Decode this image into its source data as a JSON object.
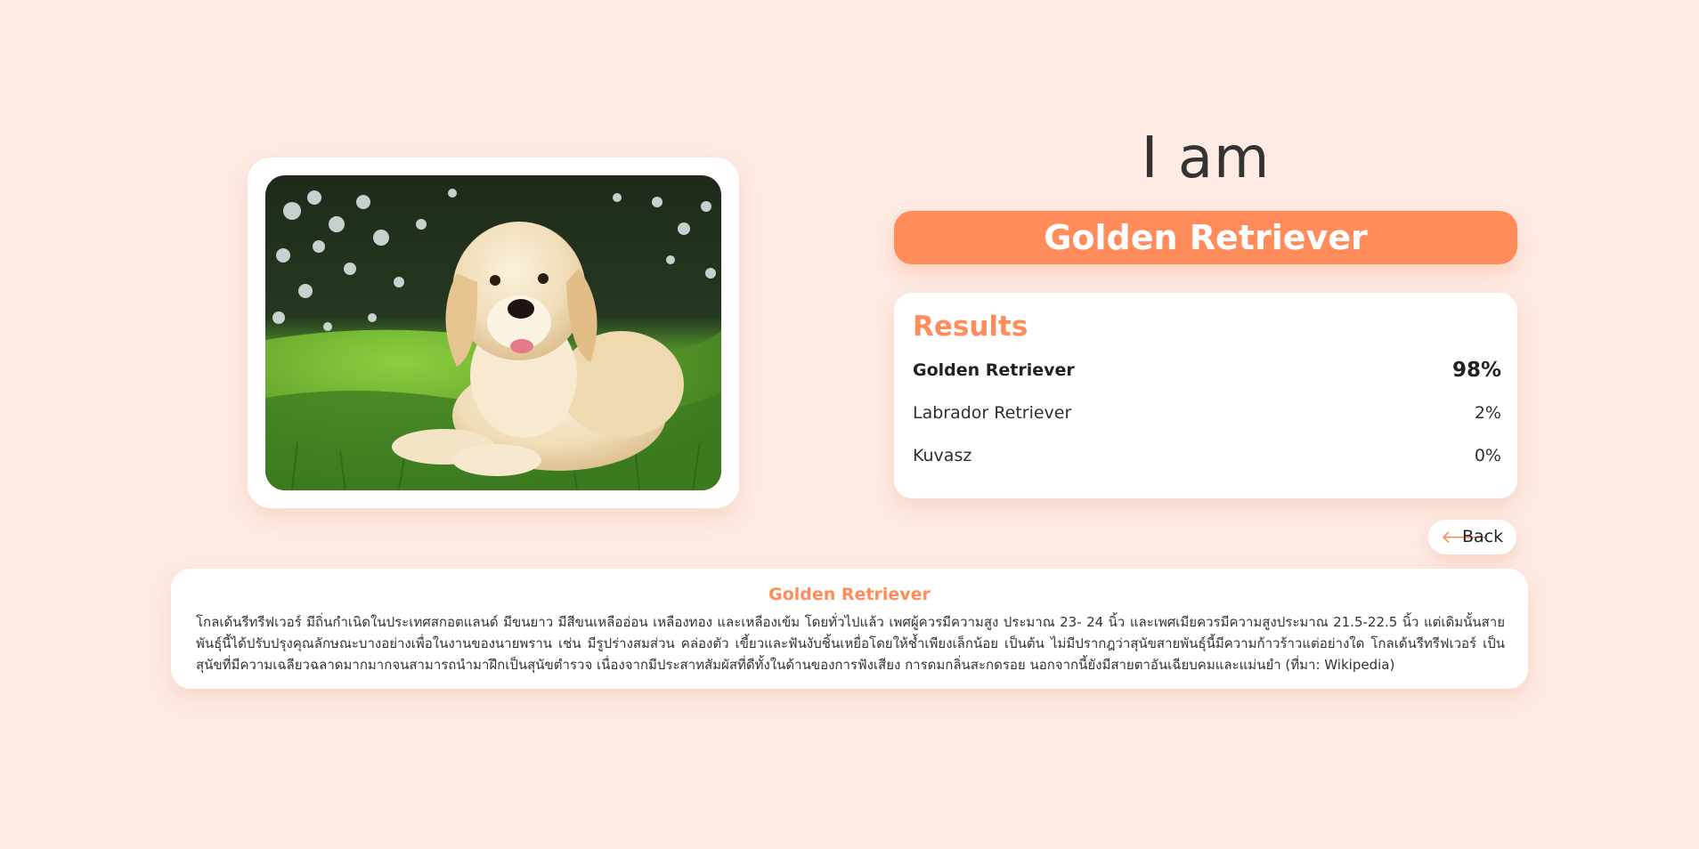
{
  "heading": "I am",
  "predicted_breed": "Golden Retriever",
  "photo": {
    "alt": "Golden Retriever puppy lying in grass"
  },
  "results": {
    "title": "Results",
    "items": [
      {
        "name": "Golden Retriever",
        "percent": "98%"
      },
      {
        "name": "Labrador Retriever",
        "percent": "2%"
      },
      {
        "name": "Kuvasz",
        "percent": "0%"
      }
    ]
  },
  "back_button": {
    "icon": "arrow-left-icon",
    "label": "Back"
  },
  "info": {
    "title": "Golden Retriever",
    "text": "โกลเด้นรีทรีฟเวอร์ มีถิ่นกำเนิดในประเทศสกอตแลนด์ มีขนยาว มีสีขนเหลืออ่อน เหลืองทอง และเหลืองเข้ม โดยทั่วไปแล้ว เพศผู้ควรมีความสูง ประมาณ 23- 24 นิ้ว และเพศเมียควรมีความสูงประมาณ 21.5-22.5 นิ้ว แต่เดิมนั้นสายพันธุ์นี้ได้ปรับปรุงคุณลักษณะบางอย่างเพื่อในงานของนายพราน เช่น มีรูปร่างสมส่วน คล่องตัว เขี้ยวและฟันงับชิ้นเหยื่อโดยให้ช้ำเพียงเล็กน้อย เป็นต้น ไม่มีปรากฎว่าสุนัขสายพันธุ์นี้มีความก้าวร้าวแต่อย่างใด โกลเด้นรีทรีฟเวอร์ เป็นสุนัขที่มีความเฉลียวฉลาดมากมากจนสามารถนำมาฝึกเป็นสุนัขตำรวจ เนื่องจากมีประสาทสัมผัสที่ดีทั้งในด้านของการฟังเสียง การดมกลิ่นสะกดรอย นอกจากนี้ยังมีสายตาอันเฉียบคมและแม่นยำ (ที่มา: Wikipedia)"
  },
  "colors": {
    "background": "#fdebe4",
    "accent": "#ff8c5a",
    "card": "#ffffff"
  }
}
